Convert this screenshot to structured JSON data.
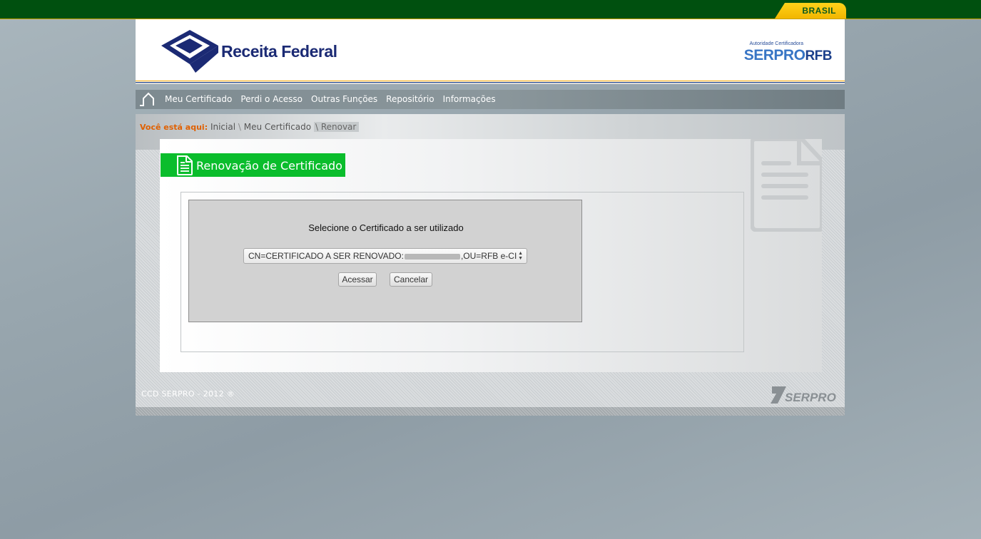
{
  "gov_bar": {
    "brasil_label": "BRASIL"
  },
  "header": {
    "logo_text": "Receita Federal",
    "authority_small": "Autoridade Certificadora",
    "authority_logo_main": "SERPRO",
    "authority_logo_suffix": "RFB"
  },
  "nav": {
    "items": [
      {
        "label": "Meu Certificado"
      },
      {
        "label": "Perdi o Acesso"
      },
      {
        "label": "Outras Funções"
      },
      {
        "label": "Repositório"
      },
      {
        "label": "Informações"
      }
    ]
  },
  "breadcrumb": {
    "label": "Você está aqui:",
    "items": [
      "Inicial",
      "Meu Certificado",
      "Renovar"
    ],
    "separator": "\\"
  },
  "section": {
    "title": "Renovação de Certificado"
  },
  "dialog": {
    "prompt": "Selecione o Certificado a ser utilizado",
    "select_prefix": "CN=CERTIFICADO A SER RENOVADO:",
    "select_suffix": ",OU=RFB e-CI",
    "accept_label": "Acessar",
    "cancel_label": "Cancelar"
  },
  "footer": {
    "copyright": "CCD SERPRO - 2012 ®",
    "logo_text": "SERPRO"
  },
  "colors": {
    "gov_green": "#00500f",
    "title_green": "#0abd2c",
    "breadcrumb_orange": "#e06000"
  }
}
